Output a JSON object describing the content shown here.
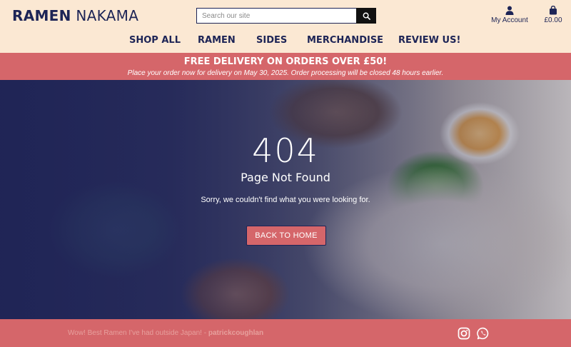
{
  "brand": {
    "name_bold": "RAMEN",
    "name_rest": "NAKAMA"
  },
  "search": {
    "placeholder": "Search our site"
  },
  "account": {
    "label": "My Account"
  },
  "bag": {
    "total": "£0.00"
  },
  "nav": {
    "items": [
      "SHOP ALL",
      "RAMEN",
      "SIDES",
      "MERCHANDISE",
      "REVIEW US!"
    ]
  },
  "promo": {
    "title": "FREE DELIVERY ON ORDERS OVER £50!",
    "subtitle": "Place your order now for delivery on May 30, 2025. Order processing will be closed 48 hours earlier."
  },
  "error": {
    "code": "404",
    "heading": "Page Not Found",
    "message": "Sorry, we couldn't find what you were looking for.",
    "button_label": "BACK TO HOME"
  },
  "footer": {
    "review_text": "Wow! Best Ramen I've had outside Japan! -",
    "review_author": "patrickcoughlan",
    "social_icons": [
      "instagram-icon",
      "whatsapp-icon"
    ]
  },
  "colors": {
    "navy": "#1d2456",
    "cream": "#fbe8d3",
    "coral": "#d5666a"
  }
}
